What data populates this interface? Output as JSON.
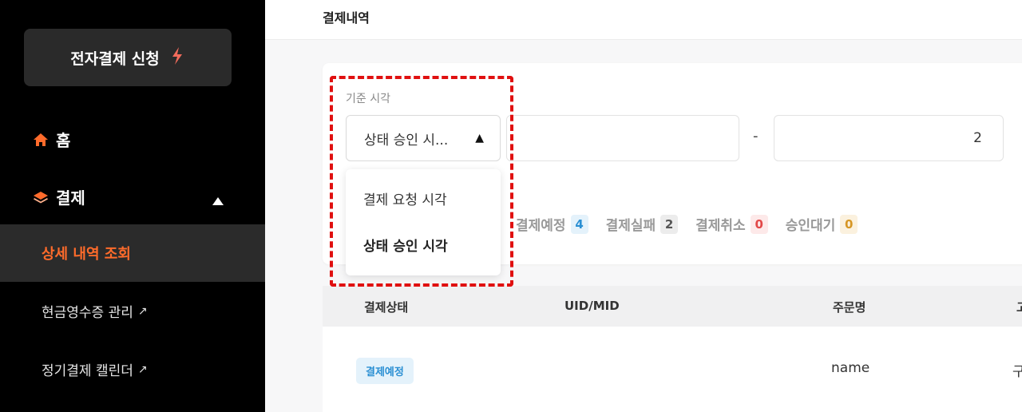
{
  "sidebar": {
    "apply_button": "전자결제 신청",
    "home": "홈",
    "payment": "결제",
    "sub_active": "상세 내역 조회",
    "sub_cash_receipt": "현금영수증 관리",
    "sub_calendar": "정기결제 캘린더",
    "external_glyph": "↗"
  },
  "header": {
    "title": "결제내역"
  },
  "filter": {
    "field_label": "기준 시각",
    "select_value": "상태 승인 시...",
    "options": [
      "결제 요청 시각",
      "상태 승인 시각"
    ],
    "date_end_partial": "2",
    "separator": "-"
  },
  "status_tabs": [
    {
      "label": "결제예정",
      "count": "4"
    },
    {
      "label": "결제실패",
      "count": "2"
    },
    {
      "label": "결제취소",
      "count": "0"
    },
    {
      "label": "승인대기",
      "count": "0"
    }
  ],
  "table": {
    "headers": [
      "결제상태",
      "UID/MID",
      "주문명",
      "고"
    ],
    "rows": [
      {
        "status": "결제예정",
        "order_name": "name",
        "cut": "구"
      }
    ]
  },
  "colors": {
    "accent": "#ff6b2b",
    "highlight_dashed": "#e01010",
    "badge_blue": "#2a8fd3"
  }
}
